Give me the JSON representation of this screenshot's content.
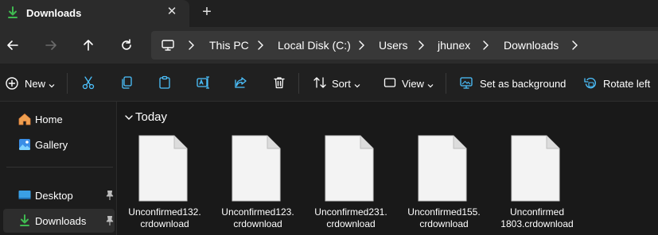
{
  "tab": {
    "title": "Downloads",
    "close_glyph": "✕",
    "new_glyph": "+"
  },
  "nav": {
    "back": "back-arrow-icon",
    "forward": "forward-arrow-icon",
    "up": "up-arrow-icon",
    "refresh": "refresh-icon"
  },
  "breadcrumb": [
    {
      "label": "This PC"
    },
    {
      "label": "Local Disk (C:)"
    },
    {
      "label": "Users"
    },
    {
      "label": "jhunex"
    },
    {
      "label": "Downloads"
    }
  ],
  "toolbar": {
    "new_label": "New",
    "sort_label": "Sort",
    "view_label": "View",
    "set_background_label": "Set as background",
    "rotate_left_label": "Rotate left"
  },
  "sidebar": {
    "items": [
      {
        "label": "Home"
      },
      {
        "label": "Gallery"
      },
      {
        "label": "Desktop"
      },
      {
        "label": "Downloads"
      }
    ]
  },
  "content": {
    "group_title": "Today",
    "files": [
      {
        "line1": "Unconfirmed132.",
        "line2": "crdownload"
      },
      {
        "line1": "Unconfirmed123.",
        "line2": "crdownload"
      },
      {
        "line1": "Unconfirmed231.",
        "line2": "crdownload"
      },
      {
        "line1": "Unconfirmed155.",
        "line2": "crdownload"
      },
      {
        "line1": "Unconfirmed",
        "line2": "1803.crdownload"
      }
    ]
  },
  "colors": {
    "accent": "#4cc2ff",
    "download_green": "#3fb950",
    "bg": "#191919",
    "toolbar": "#202020"
  }
}
